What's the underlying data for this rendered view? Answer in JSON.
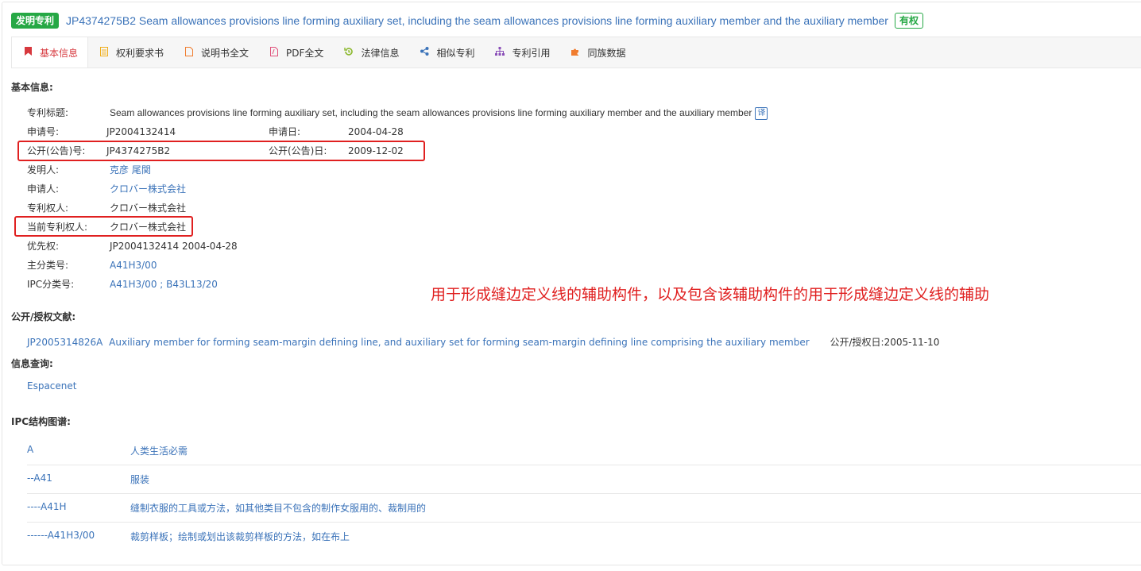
{
  "header": {
    "type_badge": "发明专利",
    "title": "JP4374275B2 Seam allowances provisions line forming auxiliary set, including the seam allowances provisions line forming auxiliary member and the auxiliary member",
    "status_badge": "有权"
  },
  "tabs": [
    {
      "label": "基本信息",
      "icon": "bookmark-icon",
      "color": "#d7383e",
      "active": true
    },
    {
      "label": "权利要求书",
      "icon": "document-icon",
      "color": "#f0ad19"
    },
    {
      "label": "说明书全文",
      "icon": "file-icon",
      "color": "#f07c2e"
    },
    {
      "label": "PDF全文",
      "icon": "pdf-icon",
      "color": "#e0507a"
    },
    {
      "label": "法律信息",
      "icon": "history-icon",
      "color": "#8bb82d"
    },
    {
      "label": "相似专利",
      "icon": "share-icon",
      "color": "#3b73b9"
    },
    {
      "label": "专利引用",
      "icon": "sitemap-icon",
      "color": "#8a4fb8"
    },
    {
      "label": "同族数据",
      "icon": "puzzle-icon",
      "color": "#f07c2e"
    }
  ],
  "basic": {
    "heading": "基本信息:",
    "title_label": "专利标题:",
    "title_value": "Seam allowances provisions line forming auxiliary set, including the seam allowances provisions line forming auxiliary member and the auxiliary member",
    "translate_icon_text": "译",
    "app_no_label": "申请号:",
    "app_no": "JP2004132414",
    "app_date_label": "申请日:",
    "app_date": "2004-04-28",
    "pub_no_label": "公开(公告)号:",
    "pub_no": "JP4374275B2",
    "pub_date_label": "公开(公告)日:",
    "pub_date": "2009-12-02",
    "inventor_label": "发明人:",
    "inventor": "克彦 尾関",
    "applicant_label": "申请人:",
    "applicant": "クロバー株式会社",
    "patentee_label": "专利权人:",
    "patentee": "クロバー株式会社",
    "current_patentee_label": "当前专利权人:",
    "current_patentee": "クロバー株式会社",
    "priority_label": "优先权:",
    "priority": "JP2004132414 2004-04-28",
    "main_class_label": "主分类号:",
    "main_class": "A41H3/00",
    "ipc_label": "IPC分类号:",
    "ipc": "A41H3/00 ; B43L13/20"
  },
  "annotation": "用于形成缝边定义线的辅助构件，以及包含该辅助构件的用于形成缝边定义线的辅助",
  "publication": {
    "heading": "公开/授权文献:",
    "doc_no": "JP2005314826A",
    "doc_title": "Auxiliary member for forming seam-margin defining line, and auxiliary set for forming seam-margin defining line comprising the auxiliary member",
    "date_label": "公开/授权日:",
    "date": "2005-11-10"
  },
  "info": {
    "heading": "信息查询:",
    "link": "Espacenet"
  },
  "ipc_tree": {
    "heading": "IPC结构图谱:",
    "rows": [
      {
        "code": "A",
        "desc": "人类生活必需"
      },
      {
        "code": "--A41",
        "desc": "服装"
      },
      {
        "code": "----A41H",
        "desc": "缝制衣服的工具或方法，如其他类目不包含的制作女服用的、裁制用的"
      },
      {
        "code": "------A41H3/00",
        "desc": "裁剪样板；绘制或划出该裁剪样板的方法，如在布上"
      }
    ]
  }
}
